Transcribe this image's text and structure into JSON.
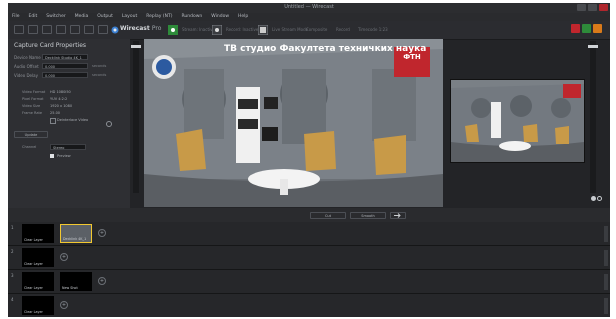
{
  "window": {
    "title": "Untitled — Wirecast"
  },
  "colors": {
    "accent_red": "#c0262d",
    "accent_green": "#2e8b3a",
    "accent_orange": "#d97a1a",
    "panel": "#2e2f33",
    "bg": "#232427"
  },
  "menu": [
    "File",
    "Edit",
    "Switcher",
    "Media",
    "Output",
    "Layout",
    "Replay (NT)",
    "Rundown",
    "Window",
    "Help"
  ],
  "toolbar": {
    "brand": "Wirecast",
    "brand_suffix": "Pro",
    "items": [
      "Stream: Inactive",
      "Record: Inactive",
      "Live Stream Mode",
      "Composite",
      "Record",
      "Timecode 1:23"
    ]
  },
  "capture": {
    "title": "Capture Card Properties",
    "rows": [
      {
        "label": "Device Name",
        "value": "Decklink Studio 4K_1",
        "unit": ""
      },
      {
        "label": "Audio Offset",
        "value": "0.000",
        "unit": "seconds"
      },
      {
        "label": "Video Delay",
        "value": "0.000",
        "unit": "seconds"
      }
    ],
    "info": [
      {
        "label": "Video Format",
        "value": "HD 1080i50"
      },
      {
        "label": "Pixel Format",
        "value": "YUV 4:2:2"
      },
      {
        "label": "Video Size",
        "value": "1920 x 1080"
      },
      {
        "label": "Frame Rate",
        "value": "25.00"
      }
    ],
    "deinterlace_label": "Deinterlace Video",
    "button_label": "Update",
    "channel_label": "Channel",
    "channel_value": "Stereo",
    "preview_checkbox": "Preview",
    "preview_checked": true
  },
  "scene": {
    "banner": "ТВ студио Факултета техничких наука",
    "logo_text": "ФТН"
  },
  "transport": {
    "cut_label": "Cut",
    "smooth_label": "Smooth"
  },
  "layers": [
    {
      "num": "1",
      "shots": [
        "Clear Layer",
        "Decklink 4K_1"
      ]
    },
    {
      "num": "2",
      "shots": [
        "Clear Layer"
      ]
    },
    {
      "num": "3",
      "shots": [
        "Clear Layer",
        "New Shot"
      ]
    },
    {
      "num": "4",
      "shots": [
        "Clear Layer"
      ]
    }
  ]
}
